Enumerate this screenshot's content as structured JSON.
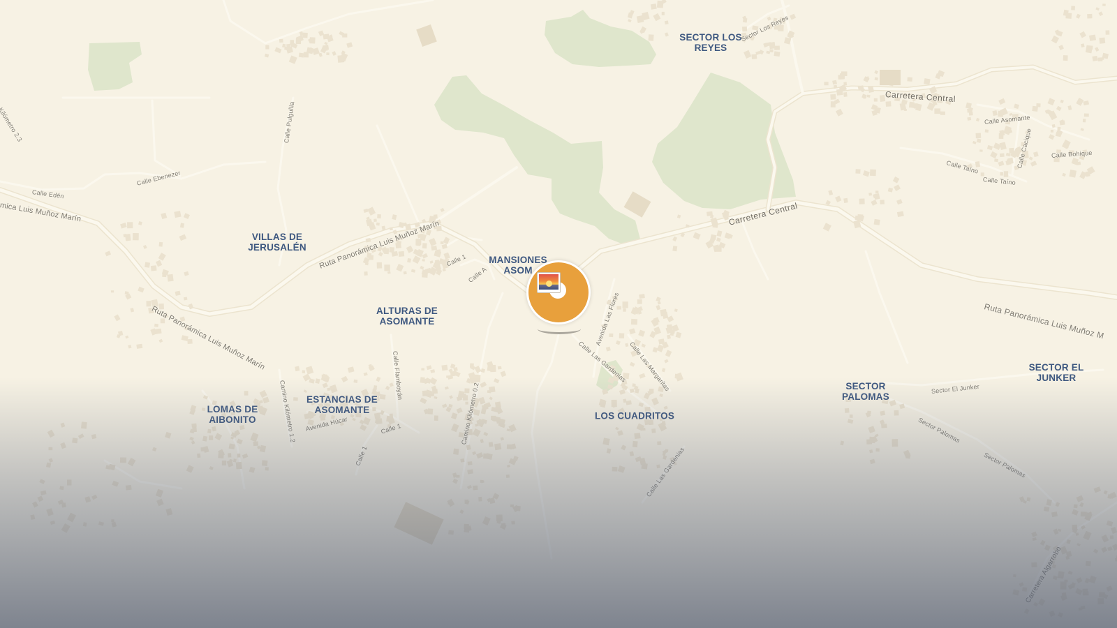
{
  "map": {
    "colors": {
      "land": "#f7f2e4",
      "park": "#dfe6cc",
      "road": "#fbf8ee",
      "road_casing": "#ece4cf",
      "building": "#ebe2cf",
      "label_area": "#3e5880",
      "marker": "#e8a03c"
    },
    "area_labels": [
      "SECTOR LOS\nREYES",
      "VILLAS DE\nJERUSALÉN",
      "MANSIONES\nASOM",
      "ALTURAS DE\nASOMANTE",
      "ESTANCIAS DE\nASOMANTE",
      "LOMAS DE\nAIBONITO",
      "LOS CUADRITOS",
      "SECTOR\nPALOMAS",
      "SECTOR EL\nJUNKER"
    ],
    "road_labels": [
      "Carretera Central",
      "Carretera Central",
      "Ruta Panorámica Luis Muñoz Marín",
      "Ruta Panorámica Luis Muñoz Marín",
      "Ruta Panorámica Luis Muñoz M",
      "mica Luis Muñoz Marín",
      "Sector Los Reyes",
      "Calle Asomante",
      "Calle Cacique",
      "Calle Bohique",
      "Calle Taíno",
      "Calle Taíno",
      "Calle Edén",
      "Calle Ebenezer",
      "Calle Pulgullia",
      "Kilómetro 2.3",
      "Calle 1",
      "Calle A",
      "Avenida Las Flores",
      "Calle Las Gardenias",
      "Calle Las Margaritas",
      "Calle Flamboyán",
      "Camino Kilómetro 1.2",
      "Avenida Húcar",
      "Calle 1",
      "Calle 1",
      "Camino Kilómetro 0.2",
      "Calle Las Gardenias",
      "Sector El Junker",
      "Sector Palomas",
      "Sector Palomas",
      "Carretera Algarrobo"
    ],
    "marker": {
      "type": "photo-pin",
      "icon": "sunset-photo-icon"
    }
  }
}
